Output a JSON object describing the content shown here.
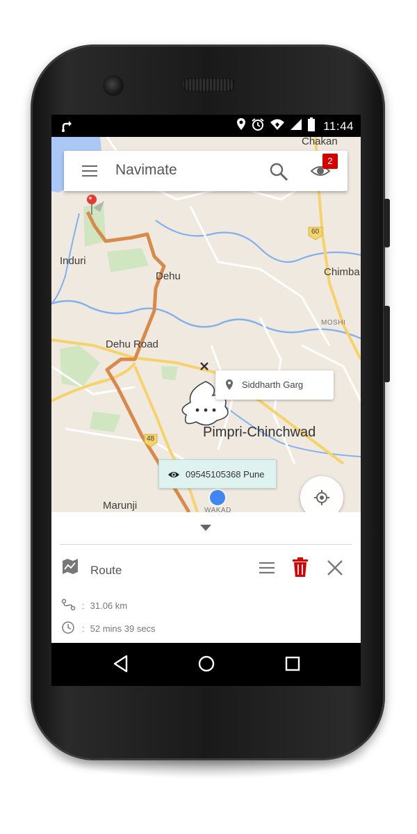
{
  "status_bar": {
    "time": "11:44",
    "icons": [
      "route-notification-icon",
      "location-icon",
      "alarm-icon",
      "wifi-icon",
      "signal-icon",
      "battery-icon"
    ]
  },
  "app": {
    "title": "Navimate",
    "watchers_badge": "2"
  },
  "map": {
    "places": [
      "Chakan",
      "Induri",
      "Dehu",
      "Chimba",
      "MOSHI",
      "Dehu Road",
      "Pimpri-Chinchwad",
      "Marunji",
      "WAKAD"
    ],
    "highway_shields": [
      "60",
      "48"
    ],
    "callout_user_name": "Siddharth  Garg",
    "callout_phone_text": "09545105368 Pune",
    "colors": {
      "land": "#f0e9df",
      "route": "#d88a4a",
      "water": "#7fb0f0",
      "highway": "#f6d36a",
      "park": "#cfe6c0",
      "location_dot": "#4285f4"
    }
  },
  "sheet": {
    "title": "Route",
    "distance": "31.06 km",
    "duration": "52 mins 39 secs",
    "separator": ":",
    "delete_color": "#d50000"
  },
  "nav_bar": {
    "icons": [
      "back-icon",
      "home-icon",
      "recents-icon"
    ]
  }
}
